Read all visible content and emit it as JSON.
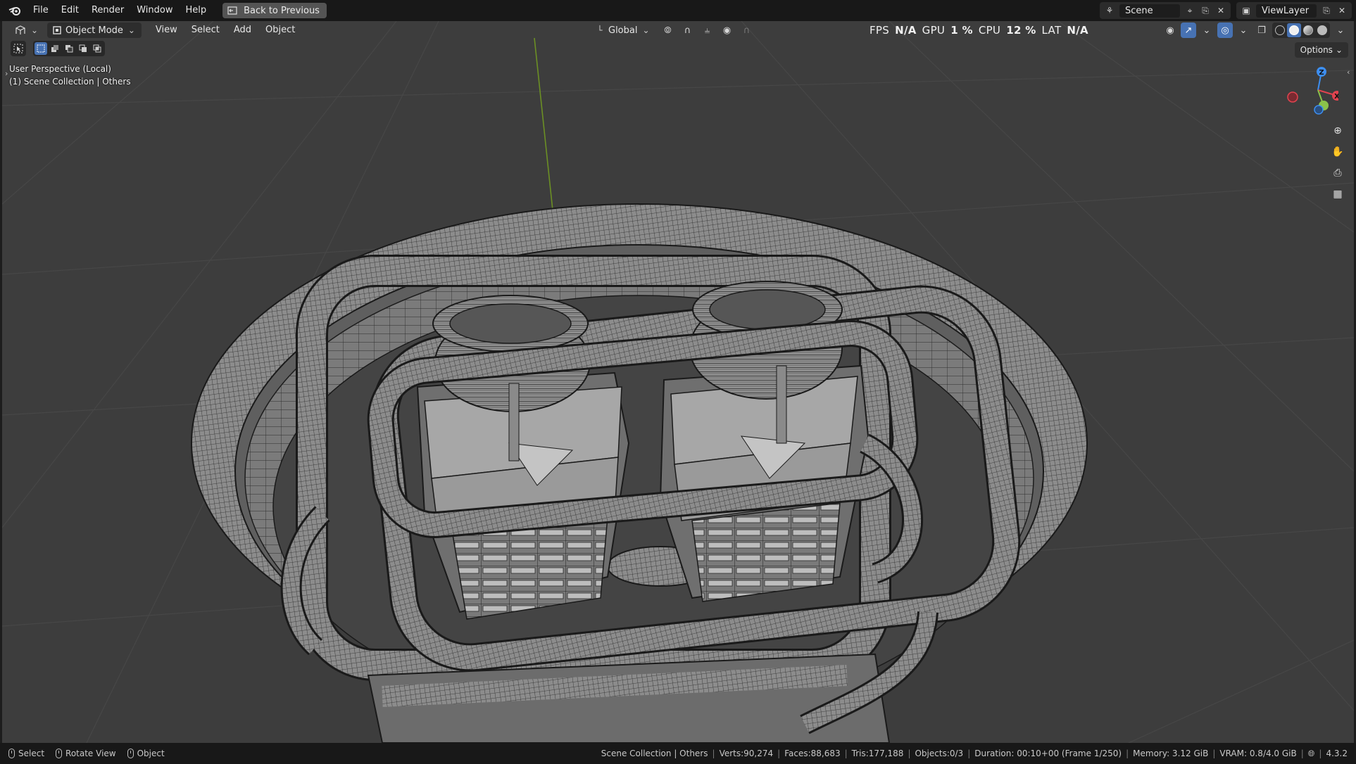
{
  "app": {
    "menus": [
      "File",
      "Edit",
      "Render",
      "Window",
      "Help"
    ],
    "back_button": "Back to Previous",
    "scene_label": "Scene",
    "view_layer_label": "ViewLayer"
  },
  "viewport_header": {
    "mode": "Object Mode",
    "menus": [
      "View",
      "Select",
      "Add",
      "Object"
    ],
    "transform_orientation": "Global",
    "options_label": "Options"
  },
  "stats": {
    "fps_label": "FPS",
    "fps_value": "N/A",
    "gpu_label": "GPU",
    "gpu_value": "1 %",
    "cpu_label": "CPU",
    "cpu_value": "12 %",
    "lat_label": "LAT",
    "lat_value": "N/A"
  },
  "view_info": {
    "line1": "User Perspective (Local)",
    "line2": "(1) Scene Collection | Others"
  },
  "gizmo": {
    "z": "Z",
    "x": "X"
  },
  "status": {
    "hints": [
      "Select",
      "Rotate View",
      "Object"
    ],
    "collection": "Scene Collection | Others",
    "verts": "Verts:90,274",
    "faces": "Faces:88,683",
    "tris": "Tris:177,188",
    "objects": "Objects:0/3",
    "duration": "Duration: 00:10+00 (Frame 1/250)",
    "memory": "Memory: 3.12 GiB",
    "vram": "VRAM: 0.8/4.0 GiB",
    "version": "4.3.2"
  },
  "colors": {
    "accent": "#4772b3",
    "viewport_bg": "#3d3d3d",
    "grid_line": "#454545",
    "y_axis": "#6b8f24",
    "mesh_fill": "#8a8a8a",
    "wire": "#1a1a1a",
    "axis_x": "#e2434f",
    "axis_y": "#8bc34a",
    "axis_z": "#3d8ef0"
  }
}
